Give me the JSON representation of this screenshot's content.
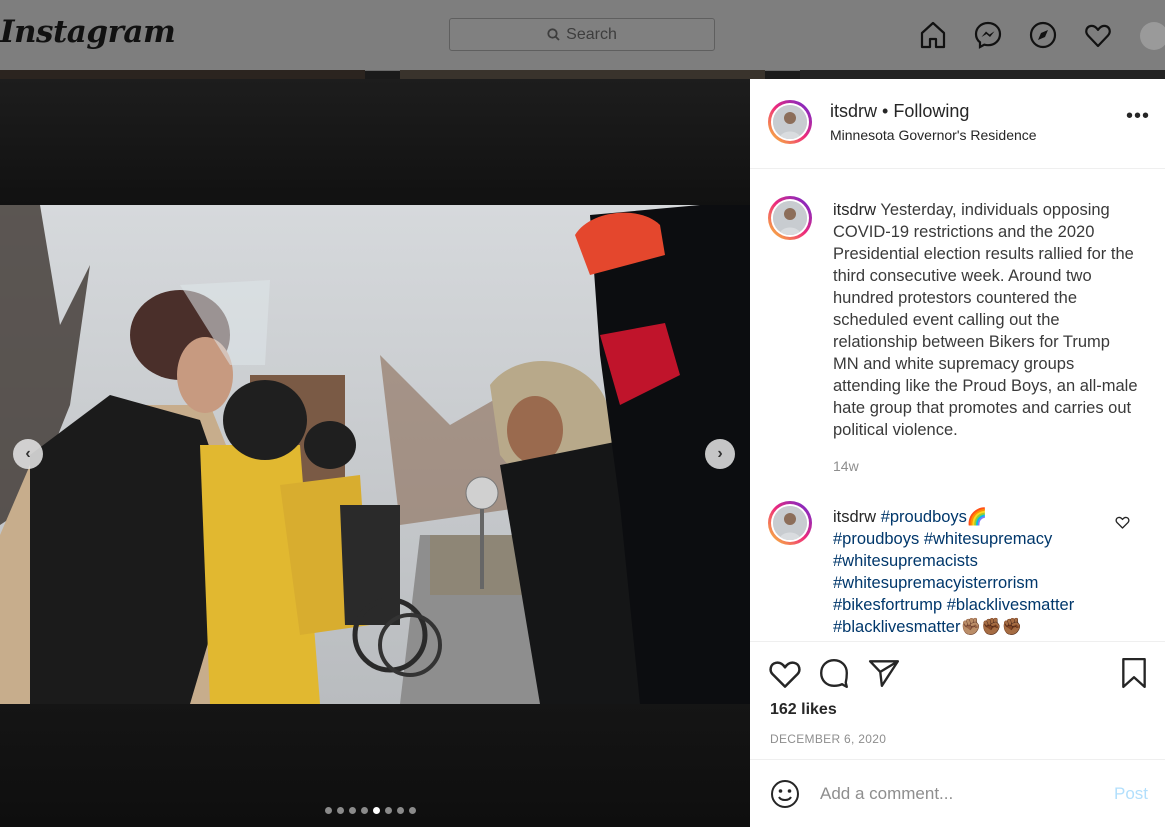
{
  "header": {
    "logo": "Instagram",
    "search_placeholder": "Search"
  },
  "post": {
    "username": "itsdrw",
    "following_label": "• Following",
    "location": "Minnesota Governor's Residence",
    "more_label": "•••",
    "caption_username": "itsdrw",
    "caption_text": "Yesterday, individuals opposing COVID-19 restrictions and the 2020 Presidential election results rallied for the third consecutive week. Around two hundred protestors countered the scheduled event calling out the relationship between Bikers for Trump MN and white supremacy groups attending like the Proud Boys, an all-male hate group that promotes and carries out political violence.",
    "caption_time": "14w",
    "comment": {
      "username": "itsdrw",
      "tags": [
        "#proudboys🌈",
        "#proudboys",
        "#whitesupremacy",
        "#whitesupremacists",
        "#whitesupremacyisterrorism",
        "#bikesfortrump",
        "#blacklivesmatter",
        "#blacklivesmatter✊🏽✊🏾✊🏾"
      ]
    },
    "likes": "162 likes",
    "date": "DECEMBER 6, 2020",
    "comment_placeholder": "Add a comment...",
    "post_button": "Post"
  },
  "carousel": {
    "prev_label": "‹",
    "next_label": "›",
    "total_slides": 8,
    "active_slide": 5
  },
  "icons": [
    "search-icon",
    "home-icon",
    "messenger-icon",
    "explore-icon",
    "heart-icon",
    "like-icon",
    "comment-icon",
    "share-icon",
    "bookmark-icon",
    "emoji-icon"
  ]
}
